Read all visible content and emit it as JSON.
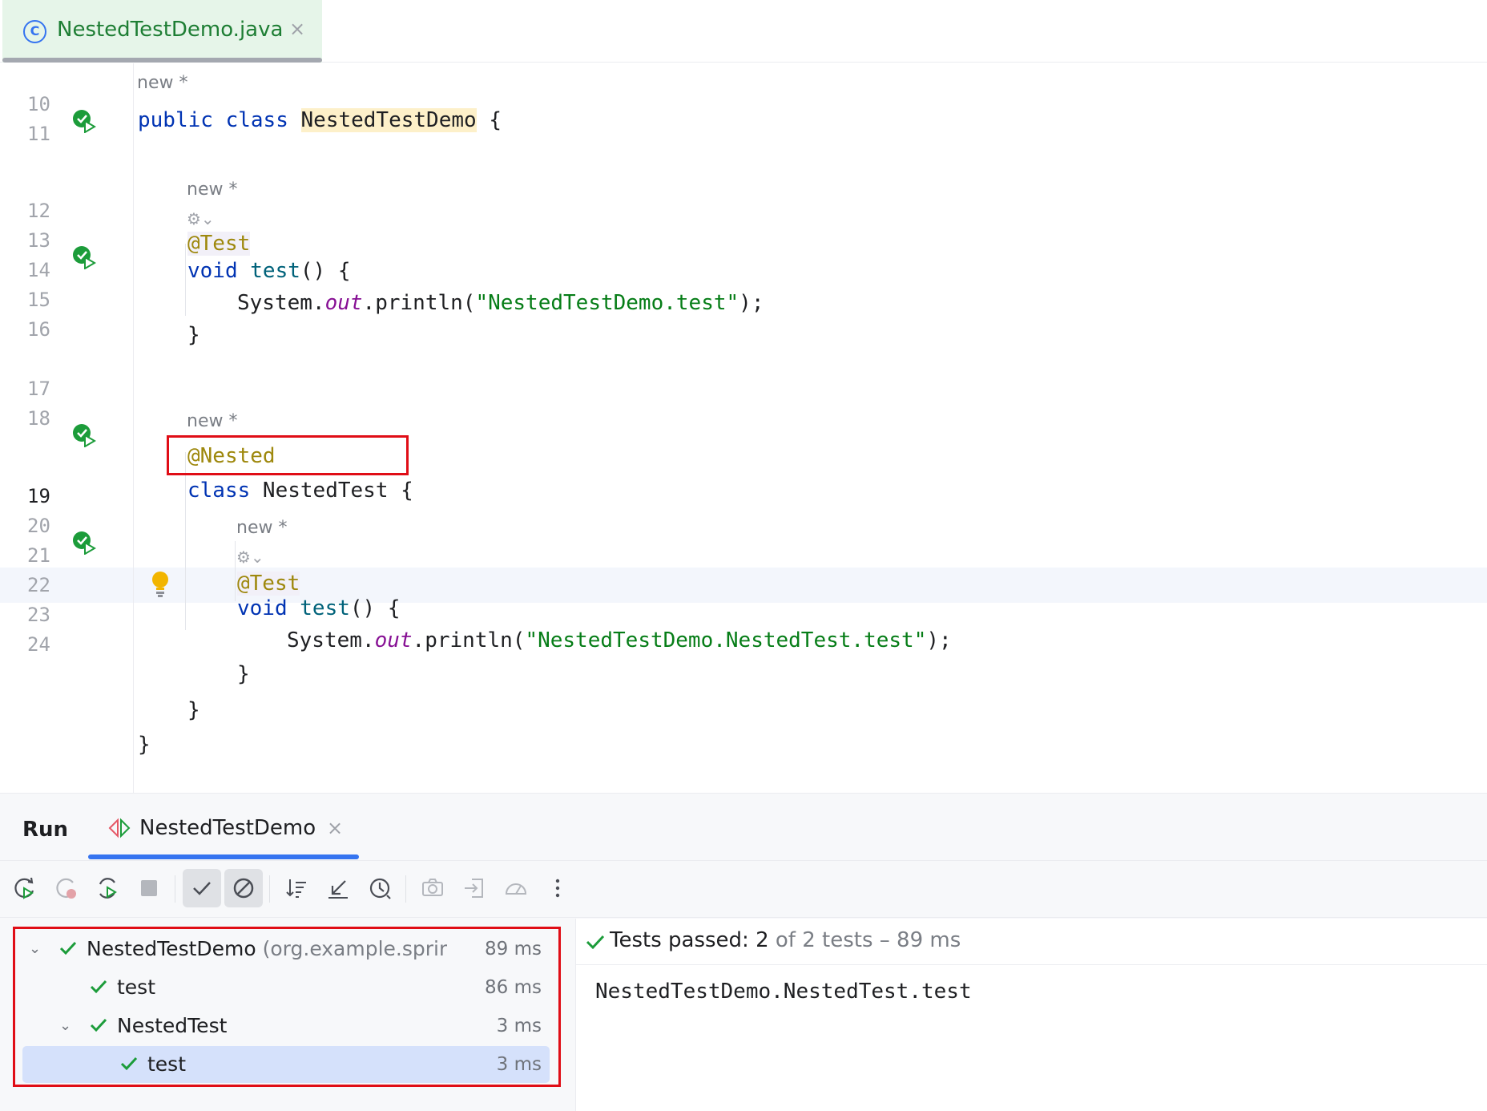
{
  "tab": {
    "filename": "NestedTestDemo.java",
    "close": "×",
    "class_icon_letter": "C"
  },
  "editor": {
    "lines": {
      "l10": "10",
      "l11": "11",
      "l12": "12",
      "l13": "13",
      "l14": "14",
      "l15": "15",
      "l16": "16",
      "l17": "17",
      "l18": "18",
      "l19": "19",
      "l20": "20",
      "l21": "21",
      "l22": "22",
      "l23": "23",
      "l24": "24"
    },
    "hint_new": "new *",
    "tokens": {
      "public": "public",
      "class": "class",
      "class_name": "NestedTestDemo",
      "open_brace": " {",
      "at_test": "@Test",
      "void": "void",
      "test": "test",
      "parens_brace": "() {",
      "system": "System.",
      "out": "out",
      "println": ".println(",
      "str1": "\"NestedTestDemo.test\"",
      "str2": "\"NestedTestDemo.NestedTest.test\"",
      "close_call": ");",
      "close_brace": "}",
      "at_nested": "@Nested",
      "nested_class_name": " NestedTest {"
    }
  },
  "run": {
    "title": "Run",
    "tab_label": "NestedTestDemo",
    "tab_close": "×",
    "tree": [
      {
        "name": "NestedTestDemo",
        "pkg": " (org.example.springboot",
        "duration": "89 ms"
      },
      {
        "name": "test",
        "duration": "86 ms"
      },
      {
        "name": "NestedTest",
        "duration": "3 ms"
      },
      {
        "name": "test",
        "duration": "3 ms"
      }
    ],
    "status": {
      "prefix": "Tests passed: ",
      "passed": "2",
      "of": " of 2 tests",
      "dash": " – 89 ms"
    },
    "console_output": "NestedTestDemo.NestedTest.test"
  },
  "colors": {
    "keyword": "#0033b3",
    "annotation": "#9e880d",
    "string": "#067d17",
    "field": "#871094",
    "method": "#00627a",
    "pass_green": "#1c9c3a",
    "highlight_red": "#e00d16",
    "accent_blue": "#3574f0"
  }
}
